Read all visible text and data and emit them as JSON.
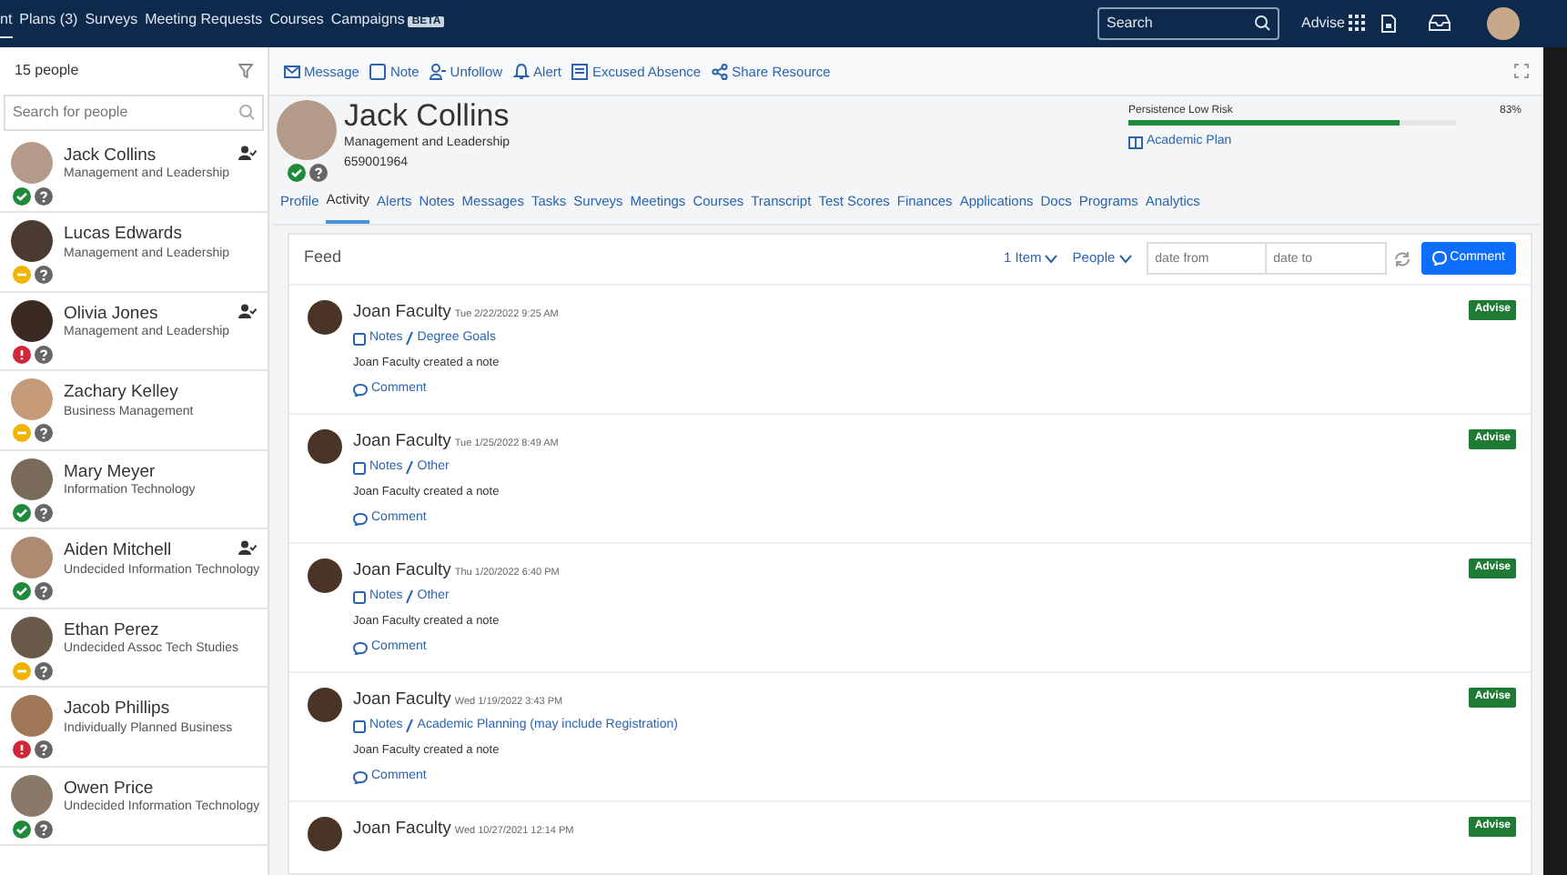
{
  "nav": {
    "tabs": [
      {
        "label": "nt",
        "selected": true
      },
      {
        "label": "Plans (3)",
        "selected": false
      },
      {
        "label": "Surveys",
        "selected": false
      },
      {
        "label": "Meeting Requests",
        "selected": false
      },
      {
        "label": "Courses",
        "selected": false
      },
      {
        "label": "Campaigns",
        "selected": false,
        "badge": "BETA"
      }
    ],
    "search": {
      "placeholder": "Search"
    },
    "app_label": "Advise"
  },
  "sidebar": {
    "count": "15 people",
    "search": {
      "placeholder": "Search for people"
    },
    "people": [
      {
        "name": "Jack Collins",
        "program": "Management and Leadership",
        "status": {
          "kind": "ok"
        },
        "followed": true
      },
      {
        "name": "Lucas Edwards",
        "program": "Management and Leadership",
        "status": {
          "kind": "warn"
        },
        "followed": false
      },
      {
        "name": "Olivia Jones",
        "program": "Management and Leadership",
        "status": {
          "kind": "alert"
        },
        "followed": true
      },
      {
        "name": "Zachary Kelley",
        "program": "Business Management",
        "status": {
          "kind": "warn"
        },
        "followed": false
      },
      {
        "name": "Mary Meyer",
        "program": "Information Technology",
        "status": {
          "kind": "ok"
        },
        "followed": false
      },
      {
        "name": "Aiden Mitchell",
        "program": "Undecided Information Technology",
        "status": {
          "kind": "ok"
        },
        "followed": true
      },
      {
        "name": "Ethan Perez",
        "program": "Undecided Assoc Tech Studies",
        "status": {
          "kind": "warn"
        },
        "followed": false
      },
      {
        "name": "Jacob Phillips",
        "program": "Individually Planned Business",
        "status": {
          "kind": "alert"
        },
        "followed": false
      },
      {
        "name": "Owen Price",
        "program": "Undecided Information Technology",
        "status": {
          "kind": "ok"
        },
        "followed": false
      }
    ]
  },
  "actions": [
    {
      "kind": "message",
      "label": "Message"
    },
    {
      "kind": "note",
      "label": "Note"
    },
    {
      "kind": "unfollow",
      "label": "Unfollow"
    },
    {
      "kind": "alert",
      "label": "Alert"
    },
    {
      "kind": "absence",
      "label": "Excused Absence"
    },
    {
      "kind": "share",
      "label": "Share Resource"
    }
  ],
  "profile": {
    "name": "Jack Collins",
    "program": "Management and Leadership",
    "id": "659001964",
    "status": {
      "kind": "ok"
    },
    "risk": {
      "label": "Persistence Low Risk",
      "level": 0.83,
      "reading": "83%"
    },
    "plan_link": "Academic Plan"
  },
  "tabs": [
    {
      "label": "Profile",
      "selected": false
    },
    {
      "label": "Activity",
      "selected": true
    },
    {
      "label": "Alerts",
      "selected": false
    },
    {
      "label": "Notes",
      "selected": false
    },
    {
      "label": "Messages",
      "selected": false
    },
    {
      "label": "Tasks",
      "selected": false
    },
    {
      "label": "Surveys",
      "selected": false
    },
    {
      "label": "Meetings",
      "selected": false
    },
    {
      "label": "Courses",
      "selected": false
    },
    {
      "label": "Transcript",
      "selected": false
    },
    {
      "label": "Test Scores",
      "selected": false
    },
    {
      "label": "Finances",
      "selected": false
    },
    {
      "label": "Applications",
      "selected": false
    },
    {
      "label": "Docs",
      "selected": false
    },
    {
      "label": "Programs",
      "selected": false
    },
    {
      "label": "Analytics",
      "selected": false
    }
  ],
  "feed": {
    "title": "Feed",
    "items_filter": "1 Item",
    "people_filter": "People",
    "date_from": {
      "placeholder": "date from"
    },
    "date_to": {
      "placeholder": "date to"
    },
    "comment_button": "Comment",
    "entries": [
      {
        "author": "Joan Faculty",
        "date": "Tue 2/22/2022 9:25 AM",
        "category": "Notes",
        "subcategory": "Degree Goals",
        "text": "Joan Faculty created a note",
        "comment": "Comment",
        "badge": "Advise"
      },
      {
        "author": "Joan Faculty",
        "date": "Tue 1/25/2022 8:49 AM",
        "category": "Notes",
        "subcategory": "Other",
        "text": "Joan Faculty created a note",
        "comment": "Comment",
        "badge": "Advise"
      },
      {
        "author": "Joan Faculty",
        "date": "Thu 1/20/2022 6:40 PM",
        "category": "Notes",
        "subcategory": "Other",
        "text": "Joan Faculty created a note",
        "comment": "Comment",
        "badge": "Advise"
      },
      {
        "author": "Joan Faculty",
        "date": "Wed 1/19/2022 3:43 PM",
        "category": "Notes",
        "subcategory": "Academic Planning (may include Registration)",
        "text": "Joan Faculty created a note",
        "comment": "Comment",
        "badge": "Advise"
      },
      {
        "author": "Joan Faculty",
        "date": "Wed 10/27/2021 12:14 PM",
        "badge": "Advise"
      }
    ]
  }
}
